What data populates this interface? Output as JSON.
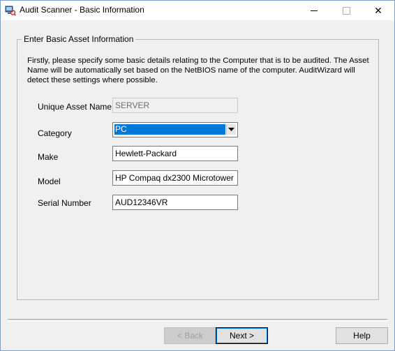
{
  "window": {
    "title": "Audit Scanner - Basic Information",
    "controls": {
      "minimize": "minimize",
      "maximize": "maximize",
      "close": "✕"
    }
  },
  "group": {
    "legend": "Enter Basic Asset Information",
    "intro": "Firstly, please specify some basic details relating to the Computer that is to be audited.  The Asset Name will be automatically set based on the NetBIOS name of the computer.  AuditWizard will detect these settings where possible."
  },
  "form": {
    "asset_name": {
      "label": "Unique Asset Name",
      "value": "SERVER"
    },
    "category": {
      "label": "Category",
      "value": "PC"
    },
    "make": {
      "label": "Make",
      "value": "Hewlett-Packard"
    },
    "model": {
      "label": "Model",
      "value": "HP Compaq dx2300 Microtower"
    },
    "serial": {
      "label": "Serial Number",
      "value": "AUD12346VR"
    }
  },
  "buttons": {
    "back": "< Back",
    "next": "Next >",
    "help": "Help"
  },
  "colors": {
    "selection": "#0078d7",
    "window_bg": "#f0f0f0",
    "border": "#7a9fc6"
  }
}
